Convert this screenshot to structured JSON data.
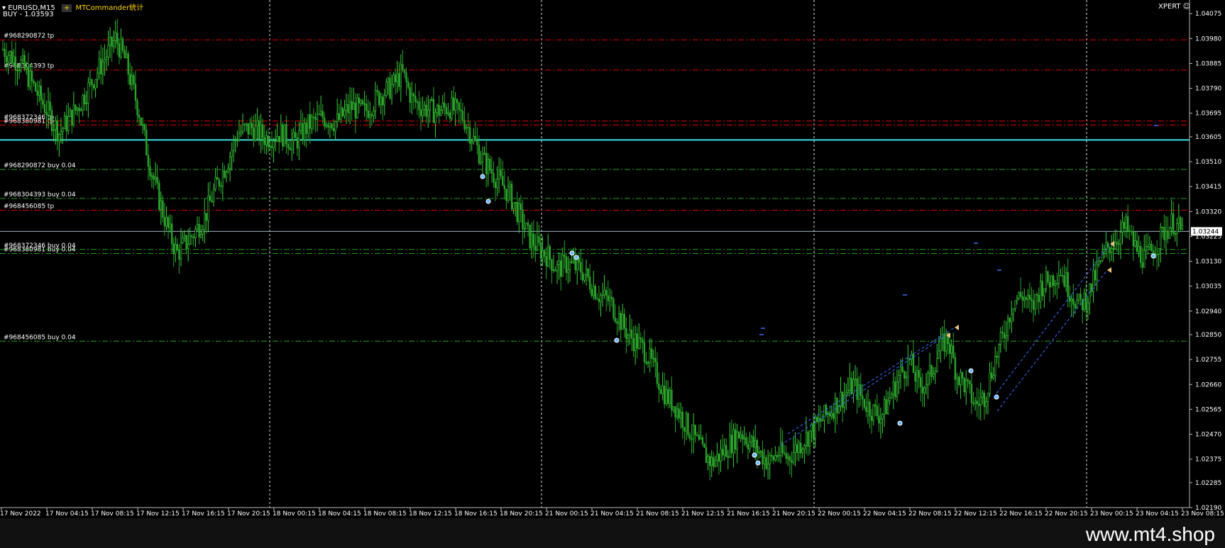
{
  "header": {
    "symbol_label": "EURUSD,M15",
    "indicator_label": "MTCommander统计",
    "buy_label": "BUY - 1.03593",
    "expert_label": "XPERT",
    "smiley": "☺",
    "arrow": "▾",
    "plus": "+"
  },
  "watermark": "www.mt4.shop",
  "chart_data": {
    "type": "candlestick",
    "symbol": "EURUSD",
    "timeframe": "M15",
    "price_axis": {
      "min": 1.0219,
      "max": 1.041,
      "ticks": [
        "1.04075",
        "1.03980",
        "1.03885",
        "1.03790",
        "1.03695",
        "1.03605",
        "1.03510",
        "1.03415",
        "1.03320",
        "1.03225",
        "1.03130",
        "1.03035",
        "1.02940",
        "1.02850",
        "1.02755",
        "1.02660",
        "1.02565",
        "1.02470",
        "1.02375",
        "1.02285",
        "1.02190"
      ],
      "current": "1.03244"
    },
    "time_axis": [
      "17 Nov 2022",
      "17 Nov 04:15",
      "17 Nov 08:15",
      "17 Nov 12:15",
      "17 Nov 16:15",
      "17 Nov 20:15",
      "18 Nov 00:15",
      "18 Nov 04:15",
      "18 Nov 08:15",
      "18 Nov 12:15",
      "18 Nov 16:15",
      "18 Nov 20:15",
      "21 Nov 00:15",
      "21 Nov 04:15",
      "21 Nov 08:15",
      "21 Nov 12:15",
      "21 Nov 16:15",
      "21 Nov 20:15",
      "22 Nov 00:15",
      "22 Nov 04:15",
      "22 Nov 08:15",
      "22 Nov 12:15",
      "22 Nov 16:15",
      "22 Nov 20:15",
      "23 Nov 00:15",
      "23 Nov 04:15",
      "23 Nov 08:15"
    ],
    "levels": [
      {
        "label": "#968290872 tp",
        "price": 1.03975,
        "kind": "tp"
      },
      {
        "label": "#968304393 tp",
        "price": 1.0386,
        "kind": "tp"
      },
      {
        "label": "#968372346 tp",
        "price": 1.03665,
        "kind": "tp"
      },
      {
        "label": "#968380981 tp",
        "price": 1.0365,
        "kind": "tp"
      },
      {
        "label": "#968290872 buy 0.04",
        "price": 1.0348,
        "kind": "buy"
      },
      {
        "label": "#968304393 buy 0.04",
        "price": 1.0337,
        "kind": "buy"
      },
      {
        "label": "#968456085 tp",
        "price": 1.03325,
        "kind": "tp"
      },
      {
        "label": "#968372346 buy 0.04",
        "price": 1.03175,
        "kind": "buy"
      },
      {
        "label": "#968380981 buy 0.04",
        "price": 1.0316,
        "kind": "buy"
      },
      {
        "label": "#968456085 buy 0.04",
        "price": 1.02825,
        "kind": "buy"
      }
    ],
    "buy_line": 1.03593,
    "path": [
      [
        0,
        1.0394
      ],
      [
        8,
        1.0388
      ],
      [
        16,
        1.0375
      ],
      [
        24,
        1.0362
      ],
      [
        32,
        1.0372
      ],
      [
        40,
        1.0385
      ],
      [
        48,
        1.0398
      ],
      [
        52,
        1.039
      ],
      [
        58,
        1.037
      ],
      [
        62,
        1.0352
      ],
      [
        66,
        1.0338
      ],
      [
        70,
        1.0326
      ],
      [
        74,
        1.0316
      ],
      [
        80,
        1.0322
      ],
      [
        86,
        1.033
      ],
      [
        90,
        1.034
      ],
      [
        96,
        1.0352
      ],
      [
        100,
        1.0362
      ],
      [
        106,
        1.0364
      ],
      [
        112,
        1.036
      ],
      [
        118,
        1.0362
      ],
      [
        124,
        1.0358
      ],
      [
        130,
        1.0365
      ],
      [
        136,
        1.0368
      ],
      [
        142,
        1.0366
      ],
      [
        148,
        1.0372
      ],
      [
        154,
        1.037
      ],
      [
        160,
        1.0376
      ],
      [
        166,
        1.038
      ],
      [
        170,
        1.0385
      ],
      [
        174,
        1.0375
      ],
      [
        178,
        1.0372
      ],
      [
        184,
        1.037
      ],
      [
        190,
        1.0372
      ],
      [
        196,
        1.0368
      ],
      [
        200,
        1.036
      ],
      [
        204,
        1.0352
      ],
      [
        210,
        1.0345
      ],
      [
        216,
        1.0338
      ],
      [
        220,
        1.033
      ],
      [
        224,
        1.0322
      ],
      [
        228,
        1.0318
      ],
      [
        232,
        1.0315
      ],
      [
        236,
        1.031
      ],
      [
        240,
        1.0312
      ],
      [
        246,
        1.031
      ],
      [
        250,
        1.0305
      ],
      [
        254,
        1.03
      ],
      [
        258,
        1.0298
      ],
      [
        262,
        1.0292
      ],
      [
        266,
        1.0285
      ],
      [
        270,
        1.0282
      ],
      [
        274,
        1.0278
      ],
      [
        278,
        1.027
      ],
      [
        282,
        1.0262
      ],
      [
        286,
        1.0258
      ],
      [
        290,
        1.0252
      ],
      [
        294,
        1.0246
      ],
      [
        298,
        1.024
      ],
      [
        302,
        1.0236
      ],
      [
        306,
        1.024
      ],
      [
        310,
        1.0244
      ],
      [
        314,
        1.0248
      ],
      [
        318,
        1.0244
      ],
      [
        322,
        1.024
      ],
      [
        326,
        1.0236
      ],
      [
        330,
        1.024
      ],
      [
        334,
        1.0238
      ],
      [
        338,
        1.0242
      ],
      [
        342,
        1.0246
      ],
      [
        346,
        1.025
      ],
      [
        350,
        1.0254
      ],
      [
        354,
        1.0258
      ],
      [
        358,
        1.0262
      ],
      [
        362,
        1.0266
      ],
      [
        366,
        1.026
      ],
      [
        370,
        1.0256
      ],
      [
        374,
        1.0254
      ],
      [
        378,
        1.0262
      ],
      [
        382,
        1.027
      ],
      [
        386,
        1.0275
      ],
      [
        390,
        1.0265
      ],
      [
        394,
        1.0268
      ],
      [
        398,
        1.0278
      ],
      [
        402,
        1.0284
      ],
      [
        406,
        1.027
      ],
      [
        410,
        1.0265
      ],
      [
        414,
        1.0258
      ],
      [
        418,
        1.0262
      ],
      [
        422,
        1.0275
      ],
      [
        426,
        1.0285
      ],
      [
        430,
        1.0298
      ],
      [
        434,
        1.03
      ],
      [
        438,
        1.0295
      ],
      [
        442,
        1.0304
      ],
      [
        446,
        1.0306
      ],
      [
        450,
        1.031
      ],
      [
        454,
        1.0302
      ],
      [
        458,
        1.0296
      ],
      [
        462,
        1.03
      ],
      [
        466,
        1.031
      ],
      [
        470,
        1.0318
      ],
      [
        474,
        1.0322
      ],
      [
        478,
        1.0326
      ],
      [
        482,
        1.0318
      ],
      [
        486,
        1.0314
      ],
      [
        490,
        1.0318
      ],
      [
        494,
        1.0324
      ],
      [
        498,
        1.0328
      ],
      [
        502,
        1.0324
      ]
    ]
  }
}
